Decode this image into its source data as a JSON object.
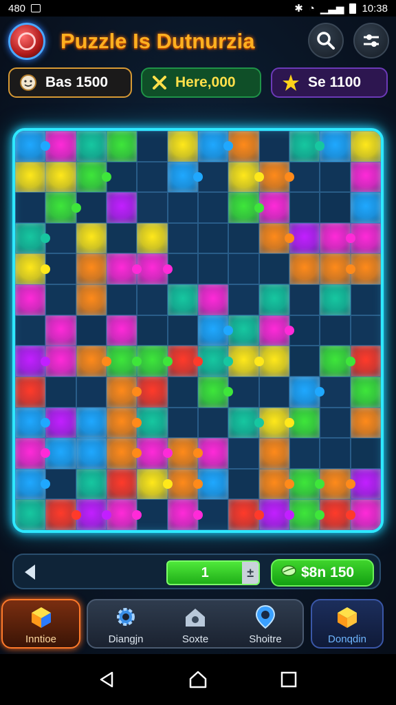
{
  "status_bar": {
    "time": "10:38",
    "left_text": "480"
  },
  "header": {
    "title": "Puzzle Is Dutnurzia"
  },
  "stats": [
    {
      "label": "Bas 1500",
      "icon": "face-coin-icon"
    },
    {
      "label": "Here,000",
      "icon": "x-cross-icon",
      "color": "#ffe04a"
    },
    {
      "label": "Se 1100",
      "icon": "star-burst-icon"
    }
  ],
  "board": {
    "columns": 12,
    "rows": 13,
    "palette": [
      "#ff8a1a",
      "#ffe81a",
      "#3ee63a",
      "#ff2ad8",
      "#1fa8ff",
      "#ff3a2a",
      "#c21fff",
      "#16c7a0"
    ]
  },
  "controls": {
    "counter_value": "1",
    "stepper_symbol": "±",
    "cash_label": "$8n 150"
  },
  "nav": [
    {
      "label": "Inntioe",
      "icon": "treasure-box-icon"
    },
    {
      "label": "Diangjn",
      "icon": "gear-icon"
    },
    {
      "label": "Soxte",
      "icon": "house-icon"
    },
    {
      "label": "Shoitre",
      "icon": "map-pin-icon"
    },
    {
      "label": "Donqdin",
      "icon": "treasure-box-icon"
    }
  ]
}
